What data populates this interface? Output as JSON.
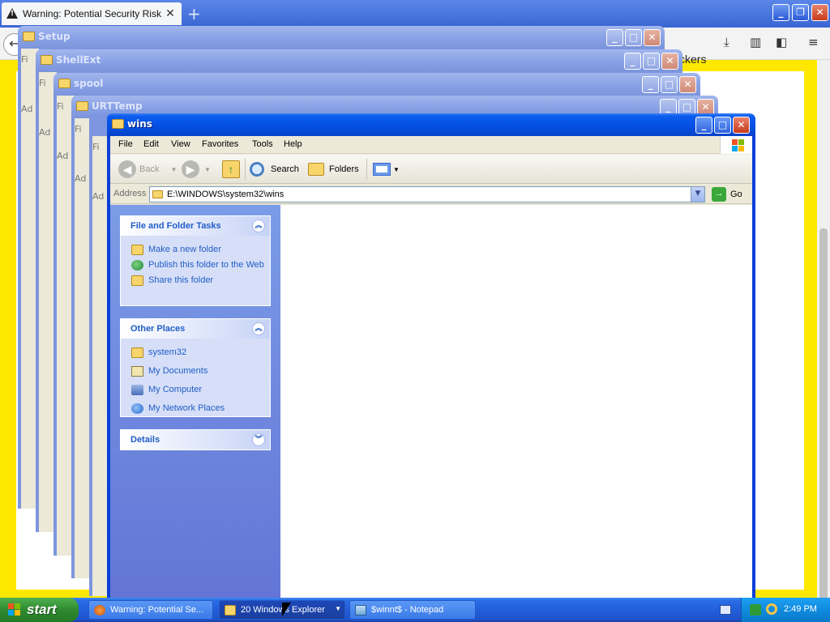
{
  "browser": {
    "tab_title": "Warning: Potential Security Risk Ahead",
    "tab_close": "✕",
    "new_tab": "+",
    "back_glyph": "←",
    "page_partial_text": "ckers",
    "controls": {
      "minimize": "_",
      "restore": "❐",
      "close": "✕"
    }
  },
  "stacked_windows": [
    {
      "title": "Setup"
    },
    {
      "title": "ShellExt"
    },
    {
      "title": "spool"
    },
    {
      "title": "URTTemp"
    }
  ],
  "stack_fragments": {
    "file_menu": "Fi",
    "address": "Ad"
  },
  "window": {
    "title": "wins",
    "controls": {
      "minimize": "_",
      "maximize": "□",
      "close": "✕"
    },
    "menu": [
      "File",
      "Edit",
      "View",
      "Favorites",
      "Tools",
      "Help"
    ],
    "toolbar": {
      "back": "Back",
      "search": "Search",
      "folders": "Folders"
    },
    "address": {
      "label": "Address",
      "value": "E:\\WINDOWS\\system32\\wins",
      "go": "Go"
    },
    "task_pane": {
      "file_tasks": {
        "title": "File and Folder Tasks",
        "items": [
          "Make a new folder",
          "Publish this folder to the Web",
          "Share this folder"
        ]
      },
      "other_places": {
        "title": "Other Places",
        "items": [
          "system32",
          "My Documents",
          "My Computer",
          "My Network Places"
        ]
      },
      "details": {
        "title": "Details"
      }
    }
  },
  "taskbar": {
    "start": "start",
    "buttons": [
      {
        "label": "Warning: Potential Se..."
      },
      {
        "label": "20 Windows Explorer"
      },
      {
        "label": "$winnt$ - Notepad"
      }
    ],
    "clock": "2:49 PM"
  },
  "colors": {
    "xp_blue": "#0a40d8",
    "task_pane_link": "#215dc6",
    "page_border_yellow": "#ffe800",
    "start_green": "#2f8a2f"
  }
}
